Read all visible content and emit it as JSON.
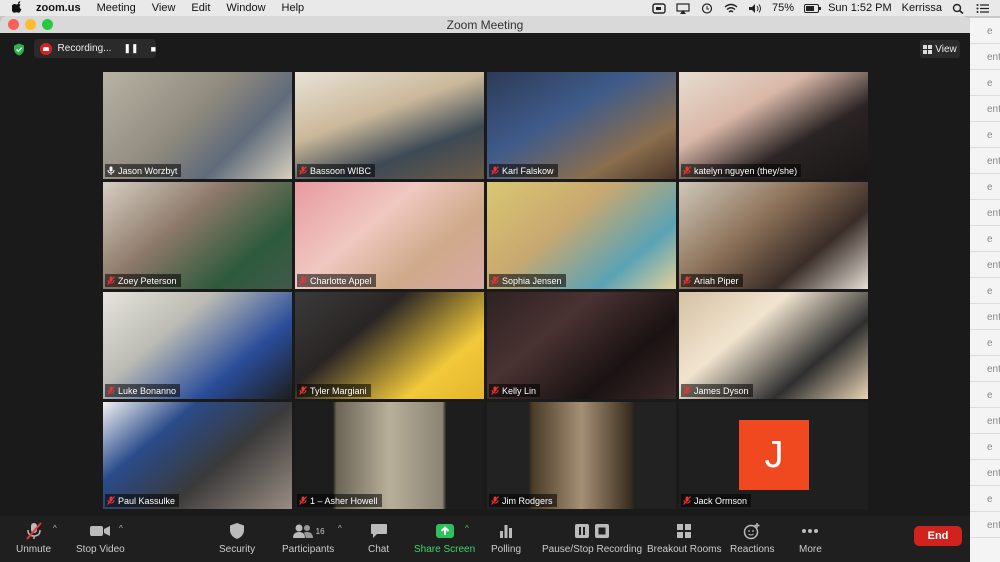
{
  "menubar": {
    "app_name": "zoom.us",
    "items": [
      "Meeting",
      "View",
      "Edit",
      "Window",
      "Help"
    ],
    "battery": "75%",
    "clock": "Sun 1:52 PM",
    "user": "Kerrissa"
  },
  "window": {
    "title": "Zoom Meeting"
  },
  "recording": {
    "label": "Recording...",
    "pause_glyph": "❚❚",
    "stop_glyph": "■"
  },
  "view_button": {
    "label": "View"
  },
  "participants": [
    {
      "name": "Jason Worzbyt",
      "muted": false,
      "active": true
    },
    {
      "name": "Bassoon WIBC",
      "muted": true
    },
    {
      "name": "Karl Falskow",
      "muted": true
    },
    {
      "name": "katelyn nguyen (they/she)",
      "muted": true
    },
    {
      "name": "Zoey Peterson",
      "muted": true
    },
    {
      "name": "Charlotte Appel",
      "muted": true
    },
    {
      "name": "Sophia Jensen",
      "muted": true
    },
    {
      "name": "Ariah Piper",
      "muted": true
    },
    {
      "name": "Luke Bonanno",
      "muted": true
    },
    {
      "name": "Tyler Margiani",
      "muted": true
    },
    {
      "name": "Kelly Lin",
      "muted": true
    },
    {
      "name": "James Dyson",
      "muted": true
    },
    {
      "name": "Paul Kassulke",
      "muted": true
    },
    {
      "name": "1 – Asher Howell",
      "muted": true
    },
    {
      "name": "Jim Rodgers",
      "muted": true
    },
    {
      "name": "Jack Ormson",
      "muted": true,
      "avatar_letter": "J"
    }
  ],
  "toolbar": {
    "unmute": "Unmute",
    "stop_video": "Stop Video",
    "security": "Security",
    "participants": "Participants",
    "participant_count": "16",
    "chat": "Chat",
    "share_screen": "Share Screen",
    "polling": "Polling",
    "pause_stop_recording": "Pause/Stop Recording",
    "breakout_rooms": "Breakout Rooms",
    "reactions": "Reactions",
    "more": "More",
    "end": "End"
  },
  "background_window": {
    "rows": [
      "e",
      "ent",
      "e",
      "ent",
      "e",
      "ent",
      "e",
      "ent",
      "e",
      "ent",
      "e",
      "ent",
      "e",
      "ent",
      "e",
      "ent",
      "e",
      "ent",
      "e",
      "ent"
    ]
  },
  "colors": {
    "accent_green": "#3fd46a",
    "end_red": "#d1231d",
    "active_speaker": "#d8e55a",
    "avatar_orange": "#f0481f"
  }
}
